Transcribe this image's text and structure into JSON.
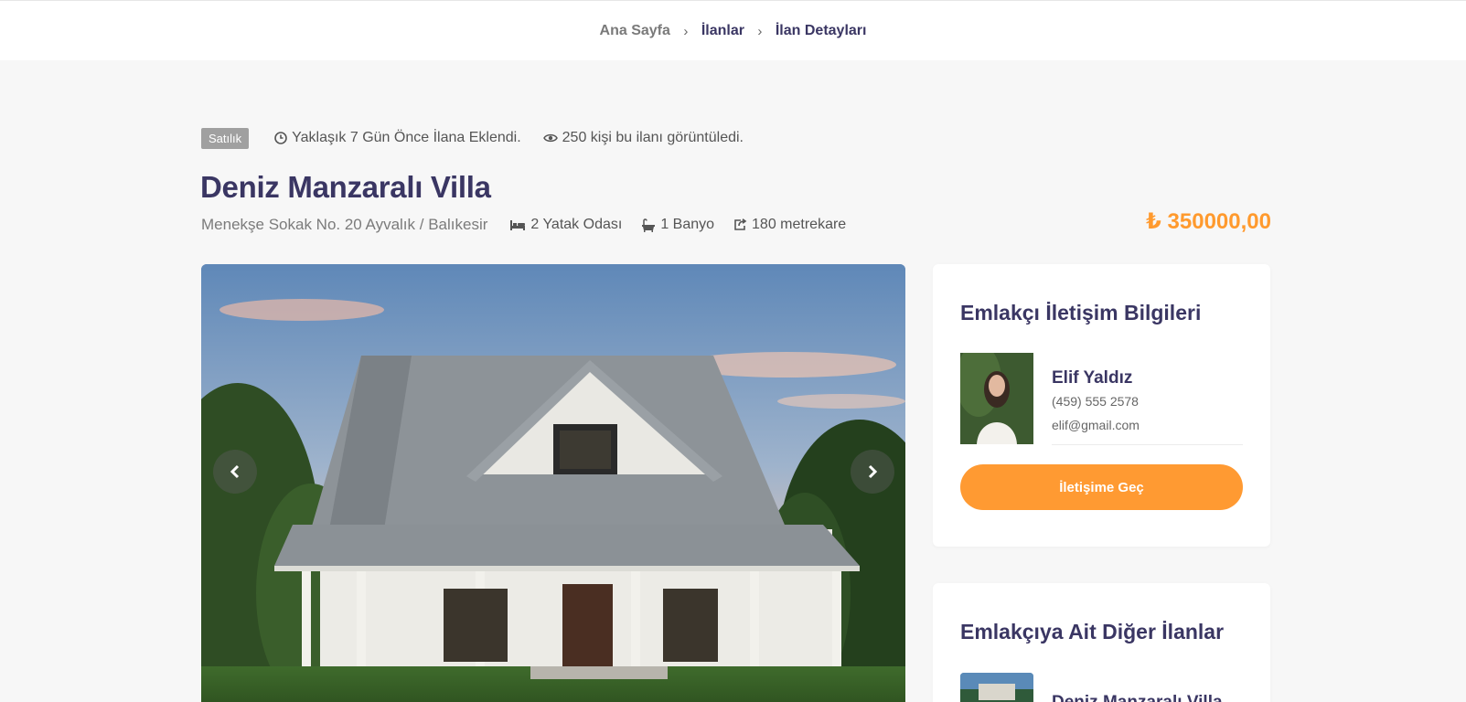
{
  "breadcrumb": {
    "home": "Ana Sayfa",
    "listings": "İlanlar",
    "detail": "İlan Detayları",
    "separator": "›"
  },
  "listing": {
    "status_badge": "Satılık",
    "added": "Yaklaşık 7 Gün Önce İlana Eklendi.",
    "views": "250 kişi bu ilanı görüntüledi.",
    "title": "Deniz Manzaralı Villa",
    "address": "Menekşe Sokak No. 20 Ayvalık / Balıkesir",
    "bedrooms": "2 Yatak Odası",
    "bathrooms": "1 Banyo",
    "area": "180 metrekare",
    "price": "₺ 350000,00"
  },
  "agent_card": {
    "title": "Emlakçı İletişim Bilgileri",
    "name": "Elif Yaldız",
    "phone": "(459) 555 2578",
    "email": "elif@gmail.com",
    "contact_button": "İletişime Geç"
  },
  "other_listings": {
    "title": "Emlakçıya Ait Diğer İlanlar",
    "items": [
      {
        "name": "Deniz Manzaralı Villa"
      }
    ]
  },
  "gallery": {
    "prev_icon": "chevron-left-icon",
    "next_icon": "chevron-right-icon"
  },
  "colors": {
    "primary": "#3a3663",
    "accent": "#ff9a32",
    "badge": "#a0a0a0",
    "background": "#f7f7f7"
  }
}
